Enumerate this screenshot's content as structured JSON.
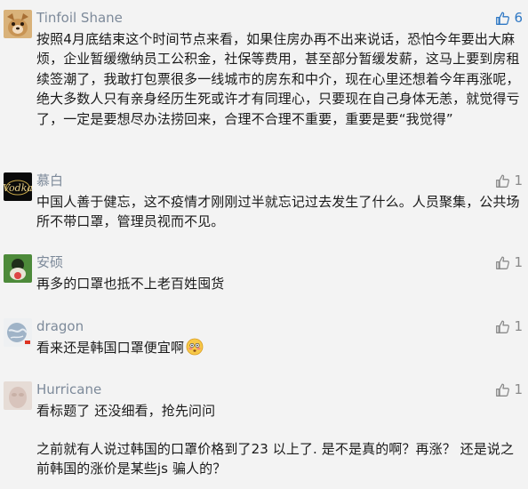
{
  "comments": [
    {
      "nickname": "Tinfoil Shane",
      "likes": "6",
      "liked": true,
      "avatar": "dog-photo-avatar",
      "text": "按照4月底结束这个时间节点来看，如果住房办再不出来说话，恐怕今年要出大麻烦，企业暂缓缴纳员工公积金，社保等费用，甚至部分暂缓发薪，这马上要到房租续签潮了，我敢打包票很多一线城市的房东和中介，现在心里还想着今年再涨呢，绝大多数人只有亲身经历生死或许才有同理心，只要现在自己身体无恙，就觉得亏了，一定是要想尽办法捞回来，合理不合理不重要，重要是要“我觉得”"
    },
    {
      "nickname": "慕白",
      "likes": "1",
      "liked": false,
      "avatar": "vodka-logo-avatar",
      "text": "中国人善于健忘，这不疫情才刚刚过半就忘记过去发生了什么。人员聚集，公共场所不带口罩，管理员视而不见。"
    },
    {
      "nickname": "安硕",
      "likes": "1",
      "liked": false,
      "avatar": "masked-person-avatar",
      "text": "再多的口罩也抵不上老百姓囤货"
    },
    {
      "nickname": "dragon",
      "likes": "1",
      "liked": false,
      "avatar": "globe-avatar",
      "text": "看来还是韩国口罩便宜啊",
      "emoji": "flushed-face-emoji"
    },
    {
      "nickname": "Hurricane",
      "likes": "1",
      "liked": false,
      "avatar": "pale-photo-avatar",
      "text": "看标题了 还没细看，抢先问问",
      "text2": "之前就有人说过韩国的口罩价格到了23 以上了. 是不是真的啊？再涨？ 还是说之前韩国的涨价是某些js 骗人的？"
    }
  ],
  "colors": {
    "background": "#f3f3f3",
    "nickname": "#7d8a9a",
    "text": "#1a1a1a",
    "like_active": "#2f78c4",
    "like_idle": "#8a8a8a"
  }
}
